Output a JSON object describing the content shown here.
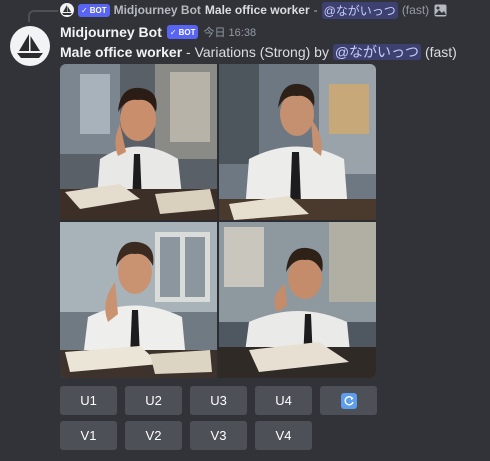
{
  "reply": {
    "badge": "BOT",
    "author": "Midjourney Bot",
    "prompt": "Male office worker",
    "separator": " - ",
    "mention": "@ながいっつ",
    "suffix": "(fast)",
    "icon": "image-icon"
  },
  "message": {
    "author": "Midjourney Bot",
    "badge": "BOT",
    "timestamp": "今日 16:38",
    "prompt": "Male office worker",
    "text_middle": " - Variations (Strong) by ",
    "mention": "@ながいっつ",
    "suffix": " (fast)"
  },
  "buttons": {
    "upscale": [
      "U1",
      "U2",
      "U3",
      "U4"
    ],
    "variation": [
      "V1",
      "V2",
      "V3",
      "V4"
    ],
    "reroll_icon": "refresh-icon"
  },
  "colors": {
    "background": "#313338",
    "button": "#4e5058",
    "badge": "#5865f2",
    "reroll": "#5c9ded"
  }
}
